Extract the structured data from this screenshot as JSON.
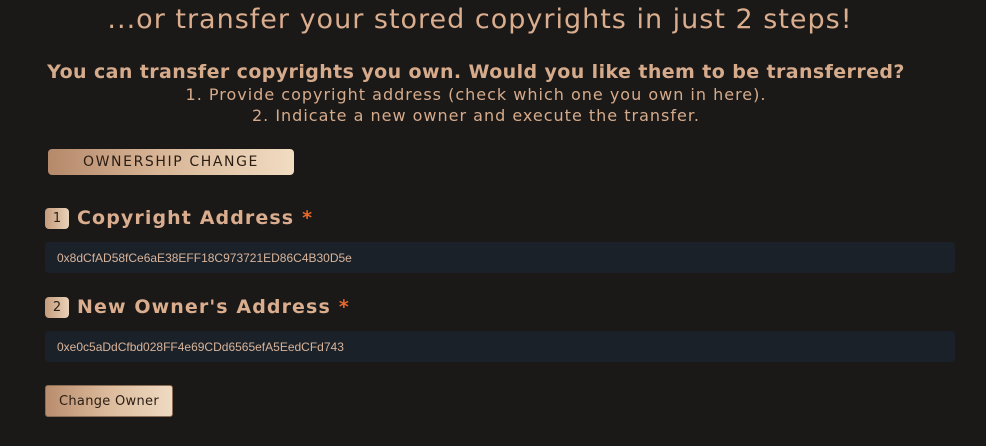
{
  "header": {
    "title": "...or transfer your stored copyrights in just 2 steps!",
    "lead": "You can transfer copyrights you own. Would you like them to be transferred?",
    "step1": "1. Provide copyright address (check which one you own in here).",
    "step2": "2. Indicate a new owner and execute the transfer."
  },
  "section": {
    "badge": "OWNERSHIP CHANGE"
  },
  "form": {
    "copyright": {
      "number": "1",
      "label": "Copyright Address",
      "required_mark": "*",
      "value": "0x8dCfAD58fCe6aE38EFF18C973721ED86C4B30D5e"
    },
    "owner": {
      "number": "2",
      "label": "New Owner's Address",
      "required_mark": "*",
      "value": "0xe0c5aDdCfbd028FF4e69CDd6565efA5EedCFd743"
    },
    "submit_label": "Change Owner"
  },
  "colors": {
    "background": "#1b1918",
    "text": "#d6ab8c",
    "required": "#e8692a",
    "input_bg": "#1b2129"
  }
}
